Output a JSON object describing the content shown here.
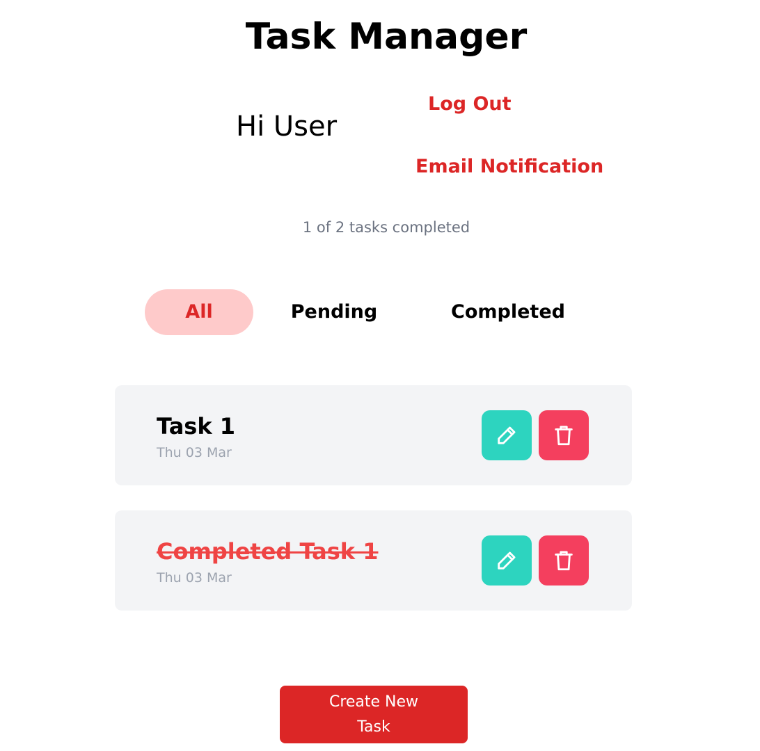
{
  "header": {
    "title": "Task Manager",
    "greeting": "Hi User",
    "logout_label": "Log Out",
    "email_notification_label": "Email Notification"
  },
  "summary": {
    "text": "1 of 2 tasks completed",
    "completed": 1,
    "total": 2
  },
  "tabs": [
    {
      "label": "All",
      "active": true
    },
    {
      "label": "Pending",
      "active": false
    },
    {
      "label": "Completed",
      "active": false
    }
  ],
  "tasks": [
    {
      "title": "Task 1",
      "date": "Thu 03 Mar",
      "completed": false,
      "edit_icon": "pencil-icon",
      "delete_icon": "trash-icon"
    },
    {
      "title": "Completed Task 1",
      "date": "Thu 03 Mar",
      "completed": true,
      "edit_icon": "pencil-icon",
      "delete_icon": "trash-icon"
    }
  ],
  "create_button": {
    "label": "Create New Task"
  },
  "colors": {
    "accent_red": "#dc2626",
    "active_tab_bg": "#fecaca",
    "edit_teal": "#2dd4bf",
    "delete_pink": "#f43f5e",
    "card_bg": "#f3f4f6",
    "completed_text": "#ef4444"
  }
}
